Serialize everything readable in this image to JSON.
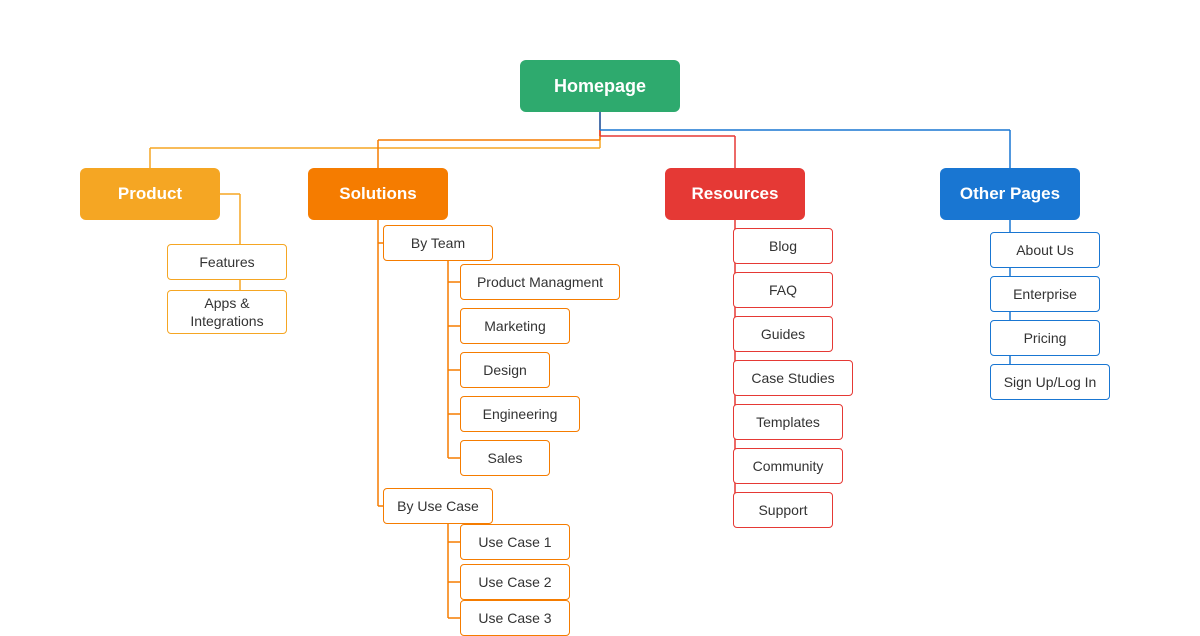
{
  "nodes": {
    "root": {
      "label": "Homepage"
    },
    "product": {
      "label": "Product"
    },
    "features": {
      "label": "Features"
    },
    "apps": {
      "label": "Apps &\nIntegrations"
    },
    "solutions": {
      "label": "Solutions"
    },
    "byteam": {
      "label": "By Team"
    },
    "pm": {
      "label": "Product Managment"
    },
    "marketing": {
      "label": "Marketing"
    },
    "design": {
      "label": "Design"
    },
    "engineering": {
      "label": "Engineering"
    },
    "sales": {
      "label": "Sales"
    },
    "byusecase": {
      "label": "By Use Case"
    },
    "uc1": {
      "label": "Use Case 1"
    },
    "uc2": {
      "label": "Use Case 2"
    },
    "uc3": {
      "label": "Use Case 3"
    },
    "resources": {
      "label": "Resources"
    },
    "blog": {
      "label": "Blog"
    },
    "faq": {
      "label": "FAQ"
    },
    "guides": {
      "label": "Guides"
    },
    "casestudies": {
      "label": "Case Studies"
    },
    "templates": {
      "label": "Templates"
    },
    "community": {
      "label": "Community"
    },
    "support": {
      "label": "Support"
    },
    "otherpages": {
      "label": "Other Pages"
    },
    "aboutus": {
      "label": "About Us"
    },
    "enterprise": {
      "label": "Enterprise"
    },
    "pricing": {
      "label": "Pricing"
    },
    "signup": {
      "label": "Sign Up/Log In"
    }
  },
  "colors": {
    "root": "#2eaa6e",
    "product": "#f5a623",
    "solutions": "#f57c00",
    "resources": "#e53935",
    "otherpages": "#1976d2"
  }
}
